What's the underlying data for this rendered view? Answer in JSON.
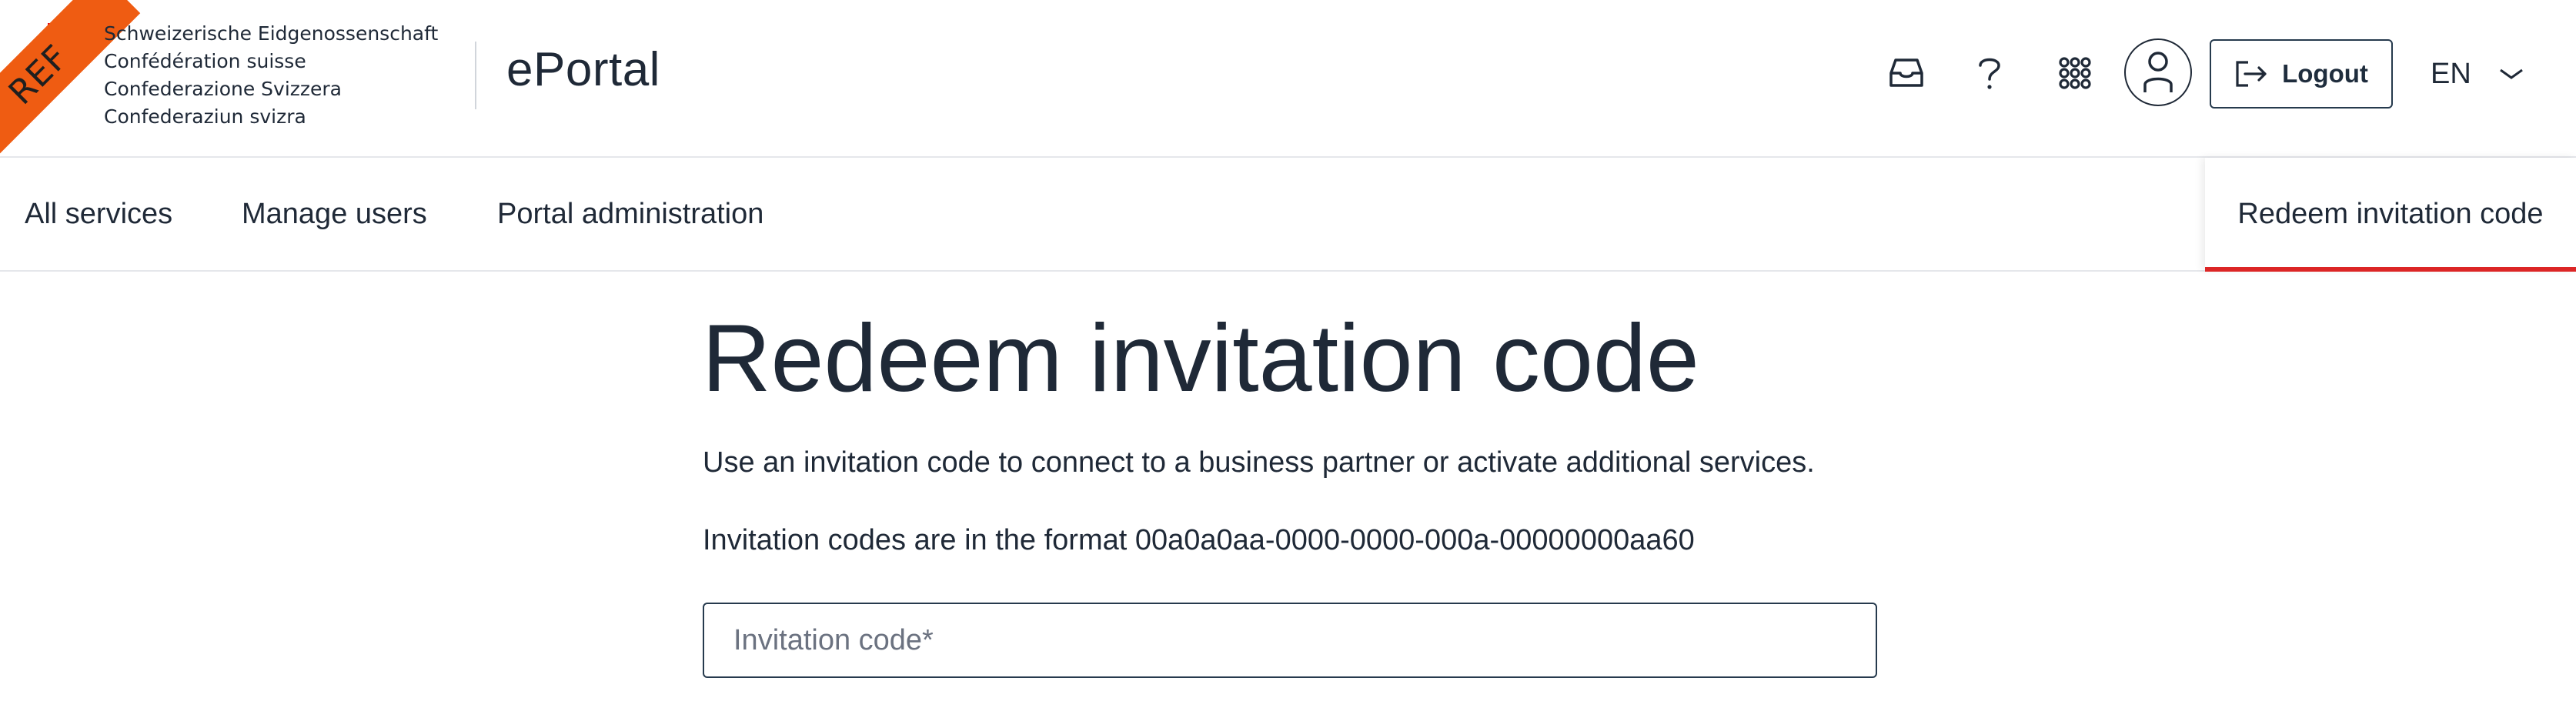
{
  "ribbon": {
    "label": "REF"
  },
  "header": {
    "confederation": [
      "Schweizerische Eidgenossenschaft",
      "Confédération suisse",
      "Confederazione Svizzera",
      "Confederaziun svizra"
    ],
    "app_title": "ePortal",
    "icons": [
      "inbox-icon",
      "help-icon",
      "apps-grid-icon",
      "user-icon"
    ],
    "logout_label": "Logout",
    "language": "EN"
  },
  "nav": {
    "items": [
      "All services",
      "Manage users",
      "Portal administration"
    ],
    "active_item": "Redeem invitation code",
    "active_color": "#dc2626"
  },
  "main": {
    "title": "Redeem invitation code",
    "description": "Use an invitation code to connect to a business partner or activate additional services.",
    "format_hint": "Invitation codes are in the format 00a0a0aa-0000-0000-000a-00000000aa60",
    "input": {
      "placeholder": "Invitation code*",
      "value": ""
    }
  },
  "colors": {
    "ribbon": "#ef5c12",
    "swiss_red": "#e3001b",
    "text": "#1f2937",
    "border": "#263a4d"
  }
}
